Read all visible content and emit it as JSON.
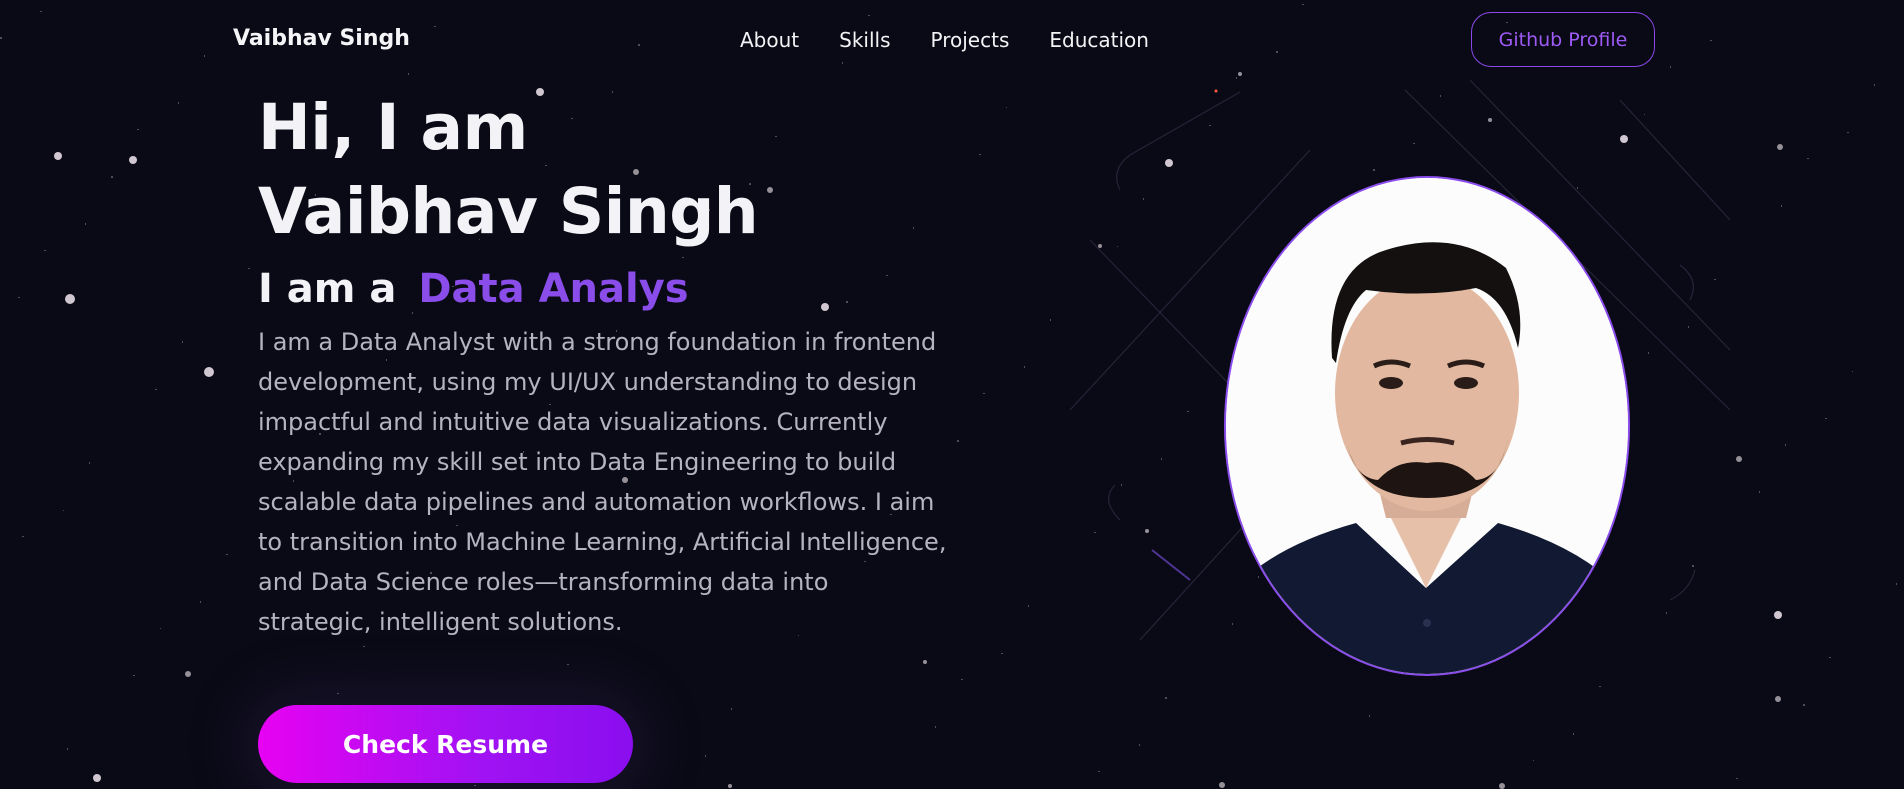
{
  "nav": {
    "brand": "Vaibhav Singh",
    "links": [
      "About",
      "Skills",
      "Projects",
      "Education"
    ],
    "github_label": "Github Profile"
  },
  "hero": {
    "greeting": "Hi, I am",
    "name": "Vaibhav Singh",
    "role_prefix": "I am a",
    "role_typed": "Data Analys",
    "description": "I am a Data Analyst with a strong foundation in frontend development, using my UI/UX understanding to design impactful and intuitive data visualizations. Currently expanding my skill set into Data Engineering to build scalable data pipelines and automation workflows. I aim to transition into Machine Learning, Artificial Intelligence, and Data Science roles—transforming data into strategic, intelligent solutions.",
    "resume_label": "Check Resume"
  },
  "colors": {
    "background": "#0a0a16",
    "accent": "#8a4dea",
    "button_gradient_start": "#e702f2",
    "button_gradient_end": "#8a0eef",
    "portrait_border": "#8b4ded"
  }
}
